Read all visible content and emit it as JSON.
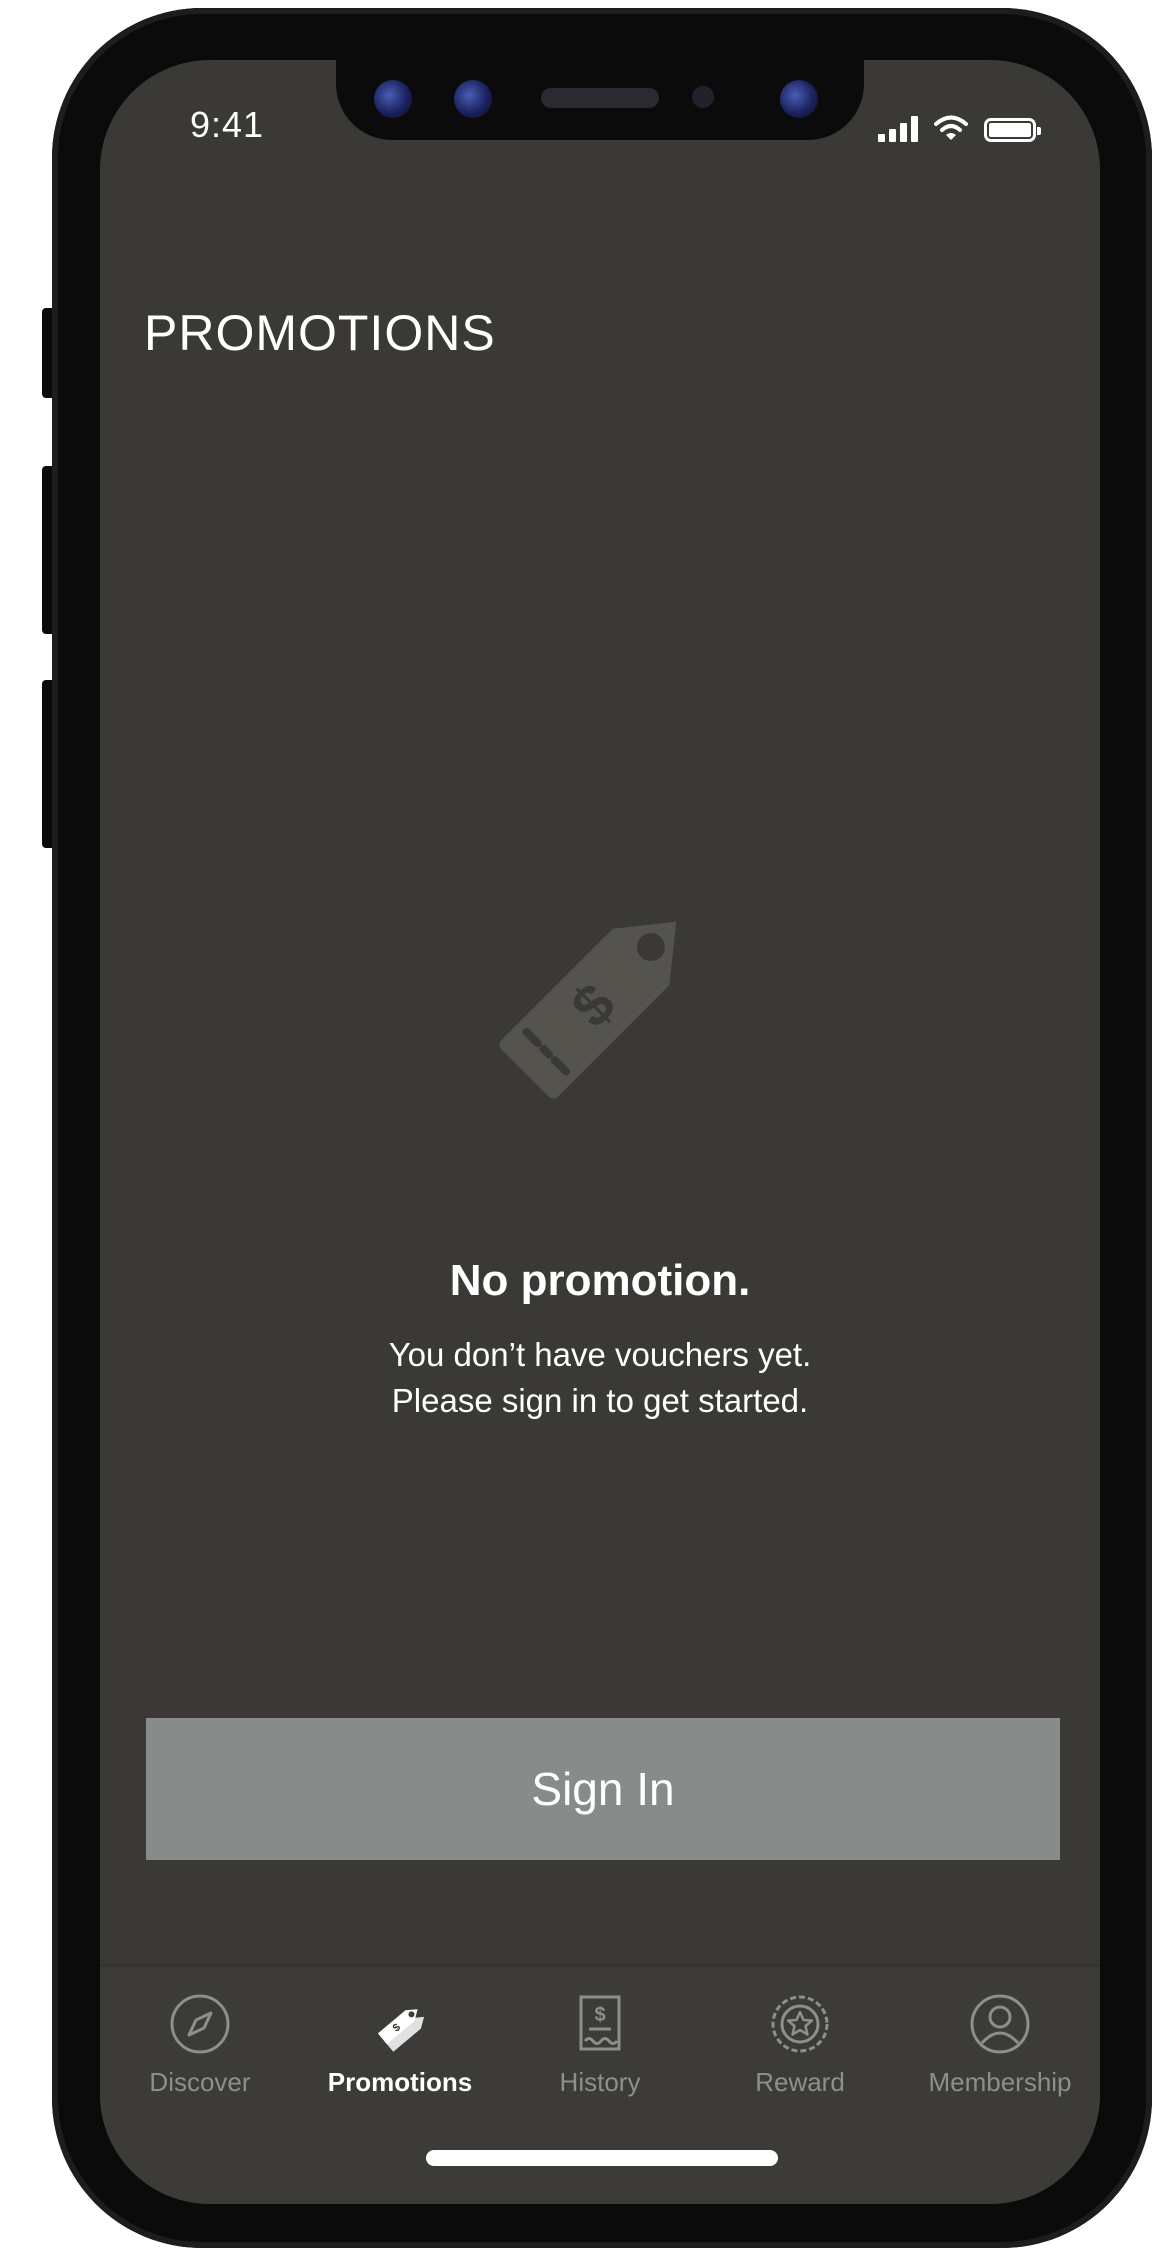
{
  "status_bar": {
    "time": "9:41"
  },
  "header": {
    "title": "PROMOTIONS"
  },
  "empty_state": {
    "icon": "price-tag-dollar-icon",
    "title": "No promotion.",
    "line1": "You don’t have vouchers yet.",
    "line2": "Please sign in to get started."
  },
  "sign_in": {
    "label": "Sign In"
  },
  "tab_bar": {
    "active": "Promotions",
    "items": [
      {
        "label": "Discover",
        "icon": "compass-icon"
      },
      {
        "label": "Promotions",
        "icon": "tags-icon"
      },
      {
        "label": "History",
        "icon": "receipt-icon"
      },
      {
        "label": "Reward",
        "icon": "star-badge-icon"
      },
      {
        "label": "Membership",
        "icon": "user-circle-icon"
      }
    ]
  },
  "colors": {
    "screen_background": "#3a3935",
    "button_background": "#878b89",
    "text_primary": "#ffffff",
    "tab_inactive": "#8e8e8a",
    "tab_active": "#ffffff",
    "illustration": "#54534e"
  }
}
